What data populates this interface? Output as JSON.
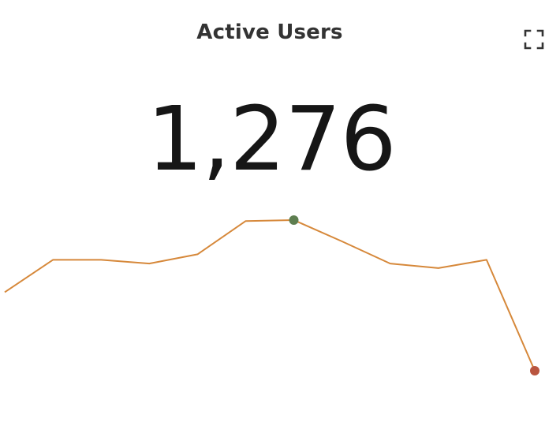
{
  "widget": {
    "title": "Active Users",
    "value": "1,276",
    "expand_icon": "expand-icon"
  },
  "colors": {
    "line": "#D6883A",
    "max_point": "#5E7E50",
    "last_point": "#B9553F",
    "title": "#333333",
    "value": "#161616"
  },
  "chart_data": {
    "type": "line",
    "title": "",
    "xlabel": "",
    "ylabel": "",
    "grid": false,
    "legend": "none",
    "values": [
      1265,
      1300,
      1300,
      1296,
      1306,
      1342,
      1343,
      1320,
      1296,
      1291,
      1300,
      1180
    ],
    "highlight_max_index": 6,
    "highlight_last_index": 11
  }
}
